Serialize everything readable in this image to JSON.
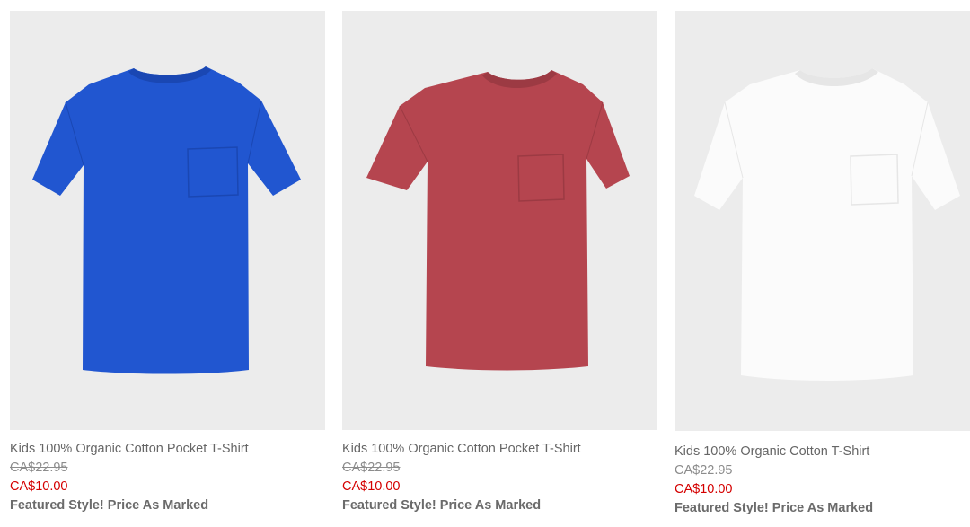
{
  "products": [
    {
      "name": "Kids 100% Organic Cotton Pocket T-Shirt",
      "original_price": "CA$22.95",
      "sale_price": "CA$10.00",
      "promo": "Featured Style! Price As Marked",
      "shirt_color": "#2156d0",
      "shirt_shade": "#1a47b3"
    },
    {
      "name": "Kids 100% Organic Cotton Pocket T-Shirt",
      "original_price": "CA$22.95",
      "sale_price": "CA$10.00",
      "promo": "Featured Style! Price As Marked",
      "shirt_color": "#b5454f",
      "shirt_shade": "#9c3a43"
    },
    {
      "name": "Kids 100% Organic Cotton T-Shirt",
      "original_price": "CA$22.95",
      "sale_price": "CA$10.00",
      "promo": "Featured Style! Price As Marked",
      "shirt_color": "#fbfbfb",
      "shirt_shade": "#e6e6e6"
    }
  ],
  "colors": {
    "image_background": "#ececec",
    "sale_price": "#d40000"
  }
}
